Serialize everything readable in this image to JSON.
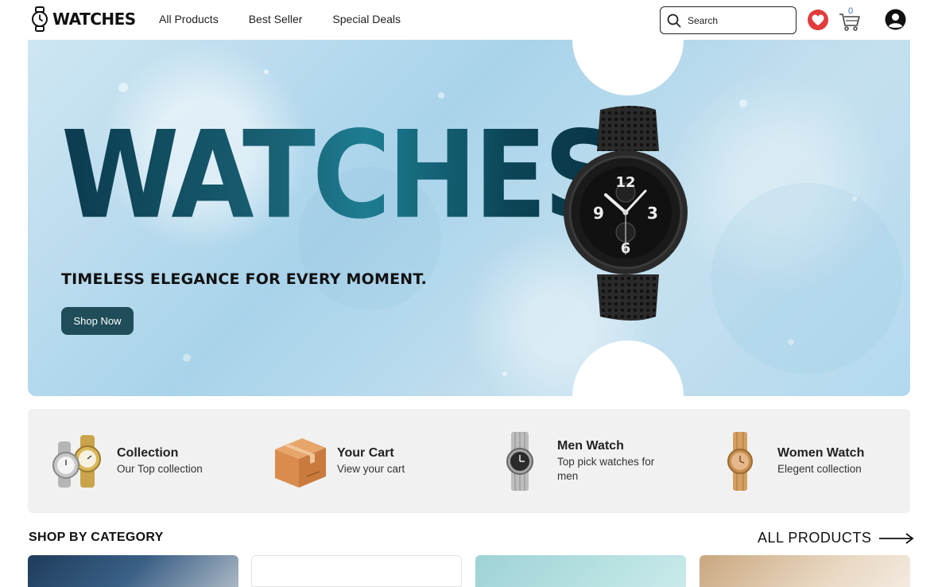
{
  "header": {
    "logo": "WATCHES",
    "nav": [
      "All Products",
      "Best Seller",
      "Special Deals"
    ],
    "search_placeholder": "Search",
    "cart_count": "0",
    "icons": [
      "watch-logo-icon",
      "search-icon",
      "heart-icon",
      "cart-icon",
      "account-icon"
    ]
  },
  "hero": {
    "title": "WATCHES",
    "subtitle": "TIMELESS ELEGANCE FOR EVERY MOMENT.",
    "cta": "Shop Now"
  },
  "features": [
    {
      "title": "Collection",
      "desc": "Our Top collection"
    },
    {
      "title": "Your Cart",
      "desc": "View your cart"
    },
    {
      "title": "Men Watch",
      "desc": "Top pick watches for men"
    },
    {
      "title": "Women Watch",
      "desc": "Elegent collection"
    }
  ],
  "categories": {
    "heading": "SHOP BY CATEGORY",
    "all_link": "ALL PRODUCTS"
  },
  "colors": {
    "accent": "#1f4e5a",
    "heart": "#e23b3b",
    "hero_bg": "#b3d9ee",
    "strip_bg": "#f1f1f1"
  }
}
